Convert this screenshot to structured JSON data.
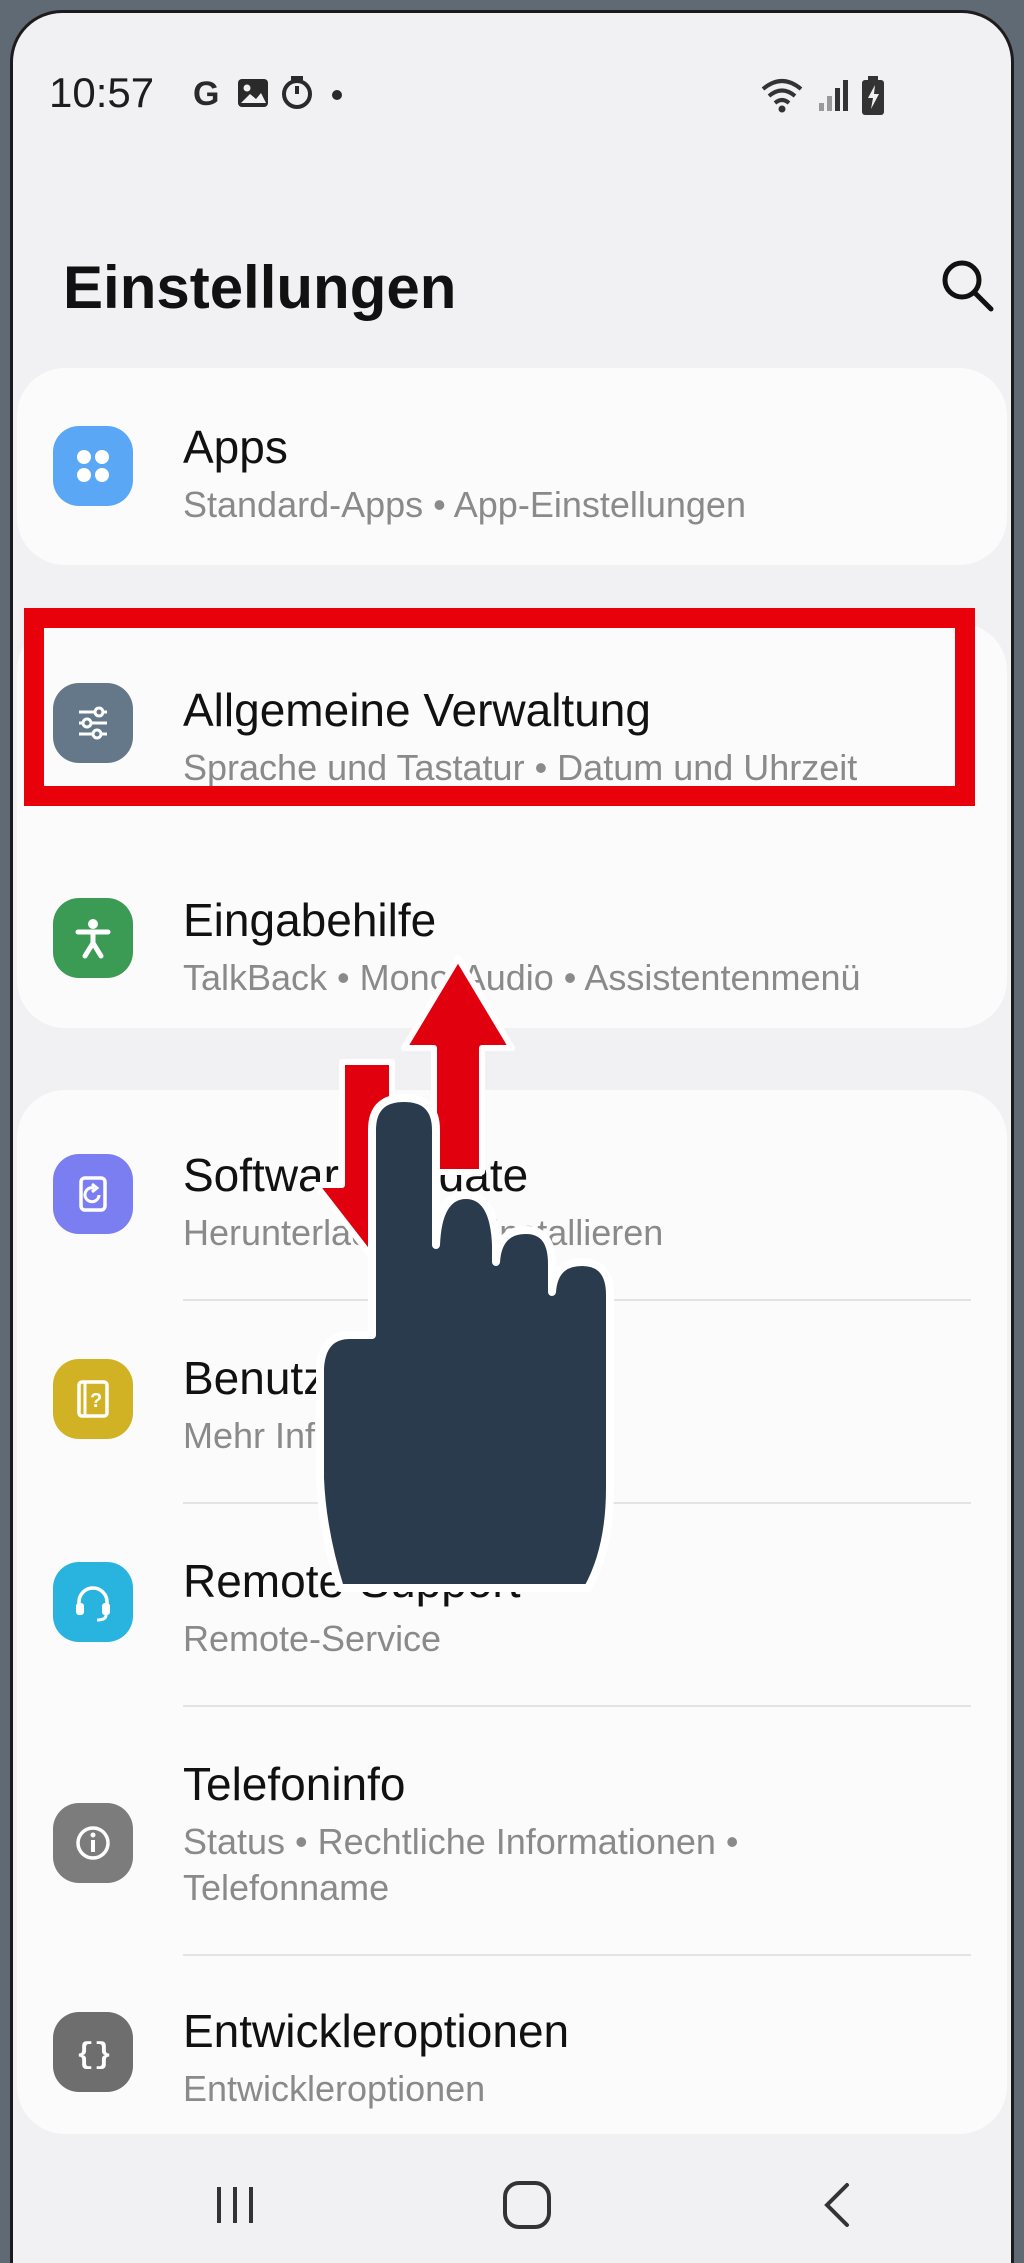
{
  "status_bar": {
    "time": "10:57",
    "left_icons": [
      "google-icon",
      "gallery-icon",
      "timer-icon",
      "dot-icon"
    ],
    "right_icons": [
      "wifi-icon",
      "signal-icon",
      "battery-charging-icon"
    ]
  },
  "header": {
    "title": "Einstellungen",
    "search_icon": "search-icon"
  },
  "items": [
    {
      "title": "Apps",
      "subtitle": "Standard-Apps  •  App-Einstellungen",
      "icon": "apps-grid-icon",
      "color": "#5aa7f6"
    },
    {
      "title": "Allgemeine Verwaltung",
      "subtitle": "Sprache und Tastatur  •  Datum und Uhrzeit",
      "icon": "sliders-icon",
      "color": "#64788a"
    },
    {
      "title": "Eingabehilfe",
      "subtitle": "TalkBack  •  Mono-Audio  •  Assistentenmenü",
      "icon": "accessibility-icon",
      "color": "#3b9a54"
    },
    {
      "title": "Software-Update",
      "subtitle": "Herunterladen und installieren",
      "icon": "software-update-icon",
      "color": "#7b7ef1"
    },
    {
      "title": "Benutzerhandbuch",
      "subtitle": "Mehr Informationen",
      "icon": "user-manual-icon",
      "color": "#d2b225"
    },
    {
      "title": "Remote-Support",
      "subtitle": "Remote-Service",
      "icon": "headset-icon",
      "color": "#29b3df"
    },
    {
      "title": "Telefoninfo",
      "subtitle": "Status  •  Rechtliche Informationen  •",
      "subtitle2": "Telefonname",
      "icon": "info-icon",
      "color": "#7c7c7c"
    },
    {
      "title": "Entwickleroptionen",
      "subtitle": "Entwickleroptionen",
      "icon": "braces-icon",
      "color": "#6e6e6e"
    }
  ],
  "highlight_color": "#e8000b",
  "gesture_overlay": {
    "icon": "swipe-up-down-hand-icon",
    "hand_color": "#2b3b4e",
    "arrow_color": "#e0000e"
  },
  "navbar": {
    "icons": [
      "recent-apps-icon",
      "home-icon",
      "back-icon"
    ]
  }
}
